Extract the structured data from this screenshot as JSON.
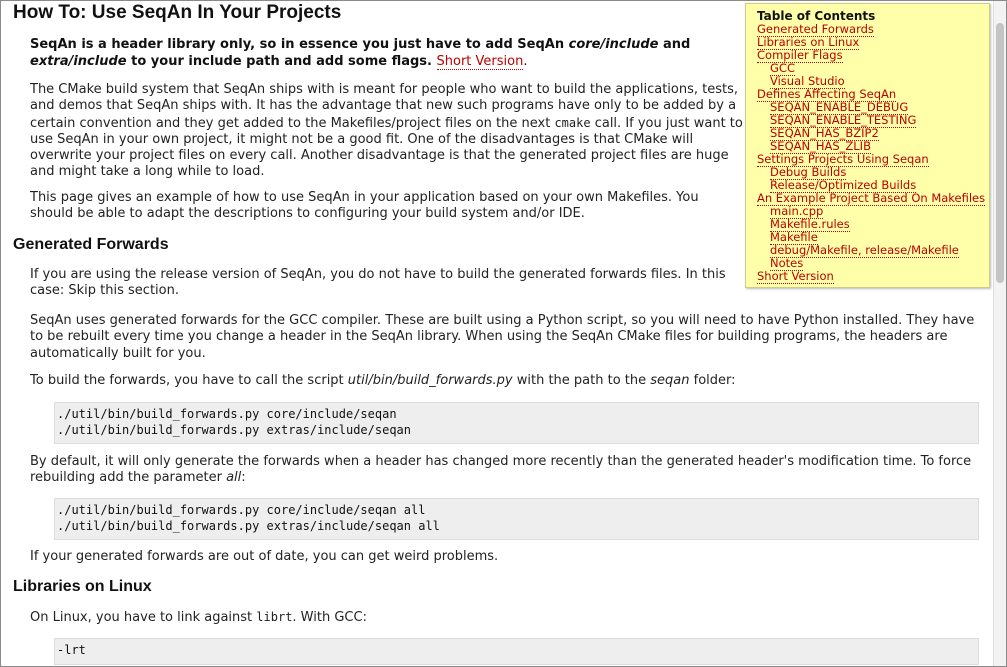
{
  "page": {
    "title": "How To: Use SeqAn In Your Projects",
    "intro": {
      "p1": "SeqAn is a header library only, so in essence you just have to add SeqAn ",
      "p1_em1": "core/include",
      "p1_and": " and",
      "p1_em2": "extra/include",
      "p1_rest": " to your include path and add some flags.",
      "short_version_link": "Short Version",
      "p1_end": ".",
      "p2a": "The CMake build system that SeqAn ships with is meant for people who want to build the applications, tests, and demos that SeqAn ships with. It has the advantage that new such programs have only to be added by a certain convention and they get added to the Makefiles/project files on the next ",
      "p2_code": "cmake",
      "p2b": " call. If you just want to use SeqAn in your own project, it might not be a good fit. One of the disadvantages is that CMake will overwrite your project files on every call. Another disadvantage is that the generated project files are huge and might take a long while to load.",
      "p3": "This page gives an example of how to use SeqAn in your application based on your own Makefiles. You should be able to adapt the descriptions to configuring your build system and/or IDE."
    },
    "generated_forwards": {
      "heading": "Generated Forwards",
      "p1": "If you are using the release version of SeqAn, you do not have to build the generated forwards files. In this case: Skip this section.",
      "p2": "SeqAn uses generated forwards for the GCC compiler. These are built using a Python script, so you will need to have Python installed. They have to be rebuilt every time you change a header in the SeqAn library. When using the SeqAn CMake files for building programs, the headers are automatically built for you.",
      "p3a": "To build the forwards, you have to call the script ",
      "p3_em1": "util/bin/build_forwards.py",
      "p3b": " with the path to the ",
      "p3_em2": "seqan",
      "p3c": " folder:",
      "code1": [
        "./util/bin/build_forwards.py core/include/seqan",
        "./util/bin/build_forwards.py extras/include/seqan"
      ],
      "p4a": "By default, it will only generate the forwards when a header has changed more recently than the generated header's modification time. To force rebuilding add the parameter ",
      "p4_em": "all",
      "p4b": ":",
      "code2": [
        "./util/bin/build_forwards.py core/include/seqan all",
        "./util/bin/build_forwards.py extras/include/seqan all"
      ],
      "p5": "If your generated forwards are out of date, you can get weird problems."
    },
    "libraries_linux": {
      "heading": "Libraries on Linux",
      "p1a": "On Linux, you have to link against ",
      "p1_code": "librt",
      "p1b": ". With GCC:",
      "code1": [
        "-lrt"
      ]
    }
  },
  "toc": {
    "title": "Table of Contents",
    "items": [
      {
        "label": "Generated Forwards",
        "level": 1
      },
      {
        "label": "Libraries on Linux",
        "level": 1
      },
      {
        "label": "Compiler Flags",
        "level": 1
      },
      {
        "label": "GCC",
        "level": 2
      },
      {
        "label": "Visual Studio",
        "level": 2
      },
      {
        "label": "Defines Affecting SeqAn",
        "level": 1
      },
      {
        "label": "SEQAN_ENABLE_DEBUG",
        "level": 2
      },
      {
        "label": "SEQAN_ENABLE_TESTING",
        "level": 2
      },
      {
        "label": "SEQAN_HAS_BZIP2",
        "level": 2
      },
      {
        "label": "SEQAN_HAS_ZLIB",
        "level": 2
      },
      {
        "label": "Settings Projects Using Seqan",
        "level": 1
      },
      {
        "label": "Debug Builds",
        "level": 2
      },
      {
        "label": "Release/Optimized Builds",
        "level": 2
      },
      {
        "label": "An Example Project Based On Makefiles",
        "level": 1
      },
      {
        "label": "main.cpp",
        "level": 2
      },
      {
        "label": "Makefile.rules",
        "level": 2
      },
      {
        "label": "Makefile",
        "level": 2
      },
      {
        "label": "debug/Makefile, release/Makefile",
        "level": 2
      },
      {
        "label": "Notes",
        "level": 2
      },
      {
        "label": "Short Version",
        "level": 1
      }
    ]
  },
  "colors": {
    "link": "#bb0000",
    "toc_background": "#ffffaa",
    "code_background": "#eeeeee"
  }
}
